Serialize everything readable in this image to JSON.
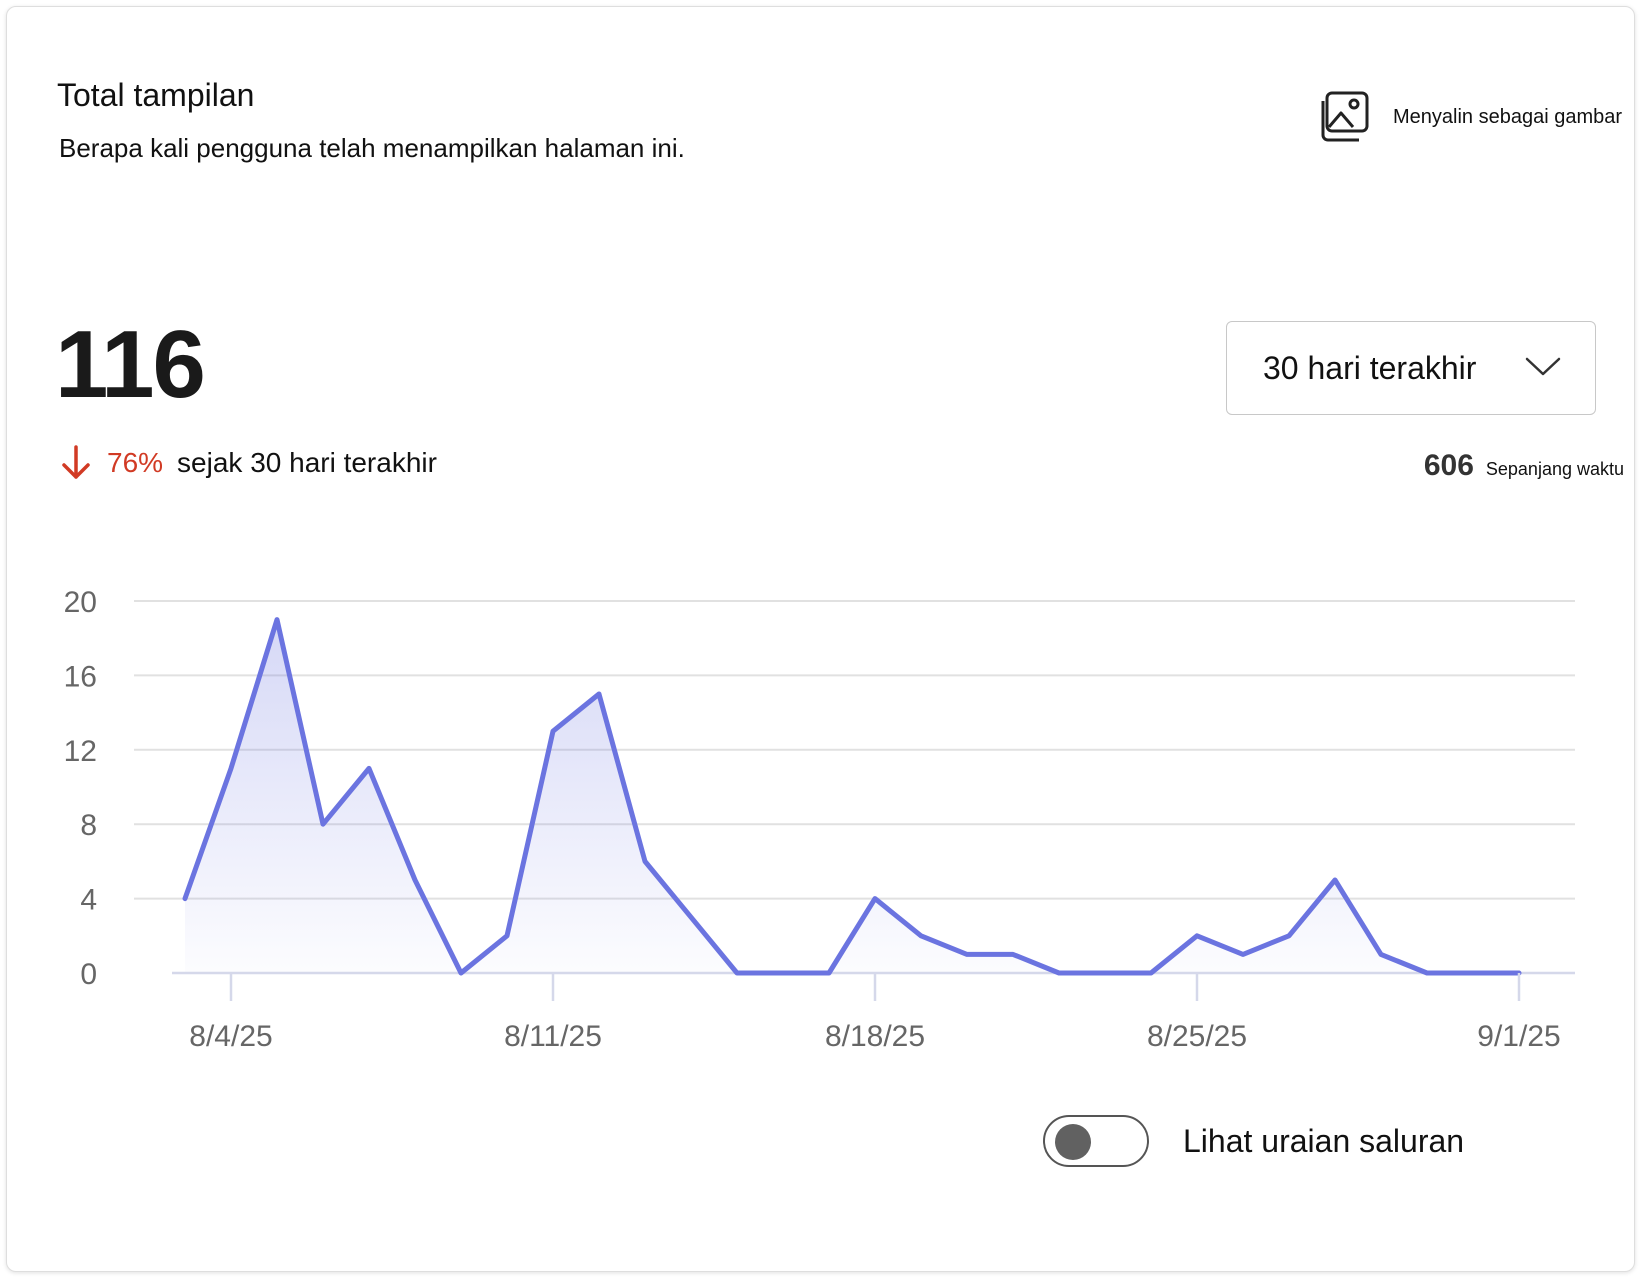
{
  "card": {
    "title": "Total tampilan",
    "subtitle": "Berapa kali pengguna telah menampilkan halaman ini.",
    "copy_button": {
      "label": "Menyalin sebagai gambar",
      "icon": "image-copy-icon"
    }
  },
  "summary": {
    "total": "116",
    "delta_icon": "arrow-down-icon",
    "delta_percent": "76%",
    "delta_text": "sejak 30 hari terakhir",
    "delta_color": "#d13a24"
  },
  "range_dropdown": {
    "selected": "30 hari terakhir",
    "icon": "chevron-down-icon"
  },
  "all_time": {
    "value": "606",
    "label": "Sepanjang waktu"
  },
  "toggle": {
    "label": "Lihat uraian saluran",
    "state": "off"
  },
  "chart_data": {
    "type": "area",
    "title": "",
    "xlabel": "",
    "ylabel": "",
    "ylim": [
      0,
      20
    ],
    "yticks": [
      0,
      4,
      8,
      12,
      16,
      20
    ],
    "x_tick_labels": [
      "8/4/25",
      "8/11/25",
      "8/18/25",
      "8/25/25",
      "9/1/25"
    ],
    "x_tick_dates": [
      "2025-08-04",
      "2025-08-11",
      "2025-08-18",
      "2025-08-25",
      "2025-09-01"
    ],
    "grid": true,
    "line_color": "#6b74e0",
    "series": [
      {
        "x": [
          "2025-08-03",
          "2025-08-04",
          "2025-08-05",
          "2025-08-06",
          "2025-08-07",
          "2025-08-08",
          "2025-08-09",
          "2025-08-10",
          "2025-08-11",
          "2025-08-12",
          "2025-08-13",
          "2025-08-14",
          "2025-08-15",
          "2025-08-16",
          "2025-08-17",
          "2025-08-18",
          "2025-08-19",
          "2025-08-20",
          "2025-08-21",
          "2025-08-22",
          "2025-08-23",
          "2025-08-24",
          "2025-08-25",
          "2025-08-26",
          "2025-08-27",
          "2025-08-28",
          "2025-08-29",
          "2025-08-30",
          "2025-08-31",
          "2025-09-01"
        ],
        "values": [
          4,
          11,
          19,
          8,
          11,
          5,
          0,
          2,
          13,
          15,
          6,
          3,
          0,
          0,
          0,
          4,
          2,
          1,
          1,
          0,
          0,
          0,
          2,
          1,
          2,
          5,
          1,
          0,
          0,
          0
        ]
      }
    ]
  }
}
